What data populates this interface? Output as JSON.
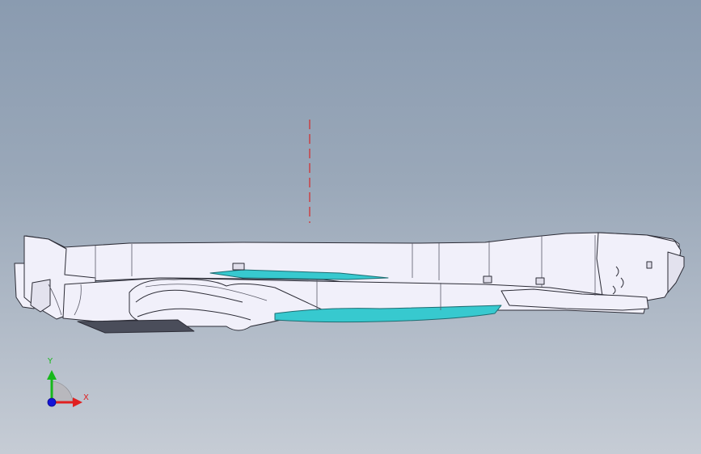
{
  "viewport": {
    "background_top": "#8a9bb0",
    "background_bottom": "#c6ccd5",
    "sketch_line_color": "#d62828"
  },
  "model": {
    "body_color": "#f1f0fa",
    "edge_color": "#2c2c36",
    "accent_color": "#37c9cf"
  },
  "triad": {
    "y_label": "Y",
    "x_label": "X",
    "y_color": "#17b81b",
    "x_color": "#e02020",
    "z_color": "#1414d8",
    "icon": "coordinate-triad-icon"
  }
}
